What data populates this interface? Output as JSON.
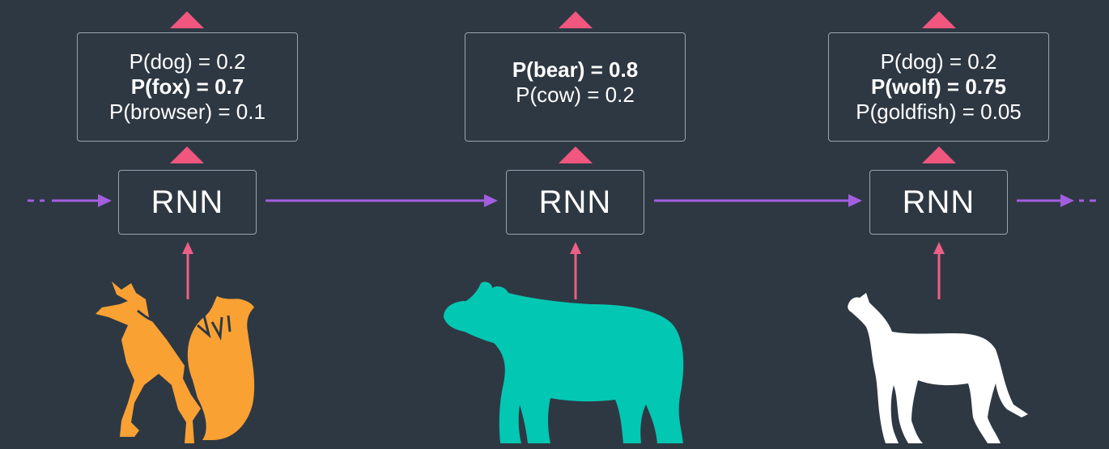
{
  "colors": {
    "background": "#2e3843",
    "box_border": "#9aa3ad",
    "text": "#ffffff",
    "output_arrow": "#f0567e",
    "input_arrow": "#ec5f86",
    "hidden_arrow": "#a35ee0",
    "fox": "#f9a133",
    "bear": "#02c7b3",
    "wolf": "#ffffff"
  },
  "timesteps": [
    {
      "rnn_label": "RNN",
      "input_icon": "fox-icon",
      "probabilities": [
        {
          "text": "P(dog) = 0.2",
          "bold": false
        },
        {
          "text": "P(fox) = 0.7",
          "bold": true
        },
        {
          "text": "P(browser) = 0.1",
          "bold": false
        }
      ]
    },
    {
      "rnn_label": "RNN",
      "input_icon": "bear-icon",
      "probabilities": [
        {
          "text": "P(bear) = 0.8",
          "bold": true
        },
        {
          "text": "P(cow) = 0.2",
          "bold": false
        }
      ]
    },
    {
      "rnn_label": "RNN",
      "input_icon": "wolf-icon",
      "probabilities": [
        {
          "text": "P(dog) = 0.2",
          "bold": false
        },
        {
          "text": "P(wolf) = 0.75",
          "bold": true
        },
        {
          "text": "P(goldfish) = 0.05",
          "bold": false
        }
      ]
    }
  ]
}
